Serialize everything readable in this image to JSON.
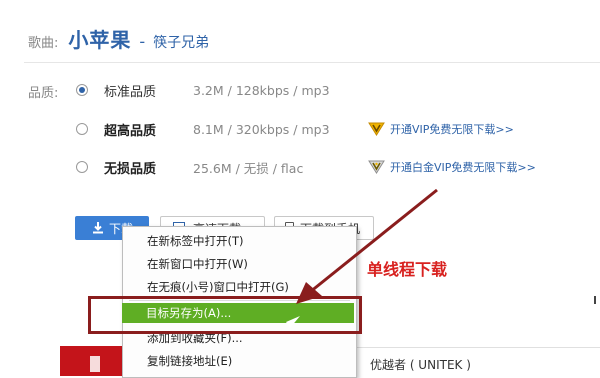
{
  "song": {
    "label": "歌曲:",
    "title": "小苹果",
    "dash": "-",
    "artist": "筷子兄弟"
  },
  "quality": {
    "label": "品质:",
    "options": [
      {
        "name": "标准品质",
        "info": "3.2M / 128kbps / mp3",
        "checked": true,
        "bold": false,
        "vip": ""
      },
      {
        "name": "超高品质",
        "info": "8.1M / 320kbps / mp3",
        "checked": false,
        "bold": true,
        "vip": "开通VIP免费无限下载>>"
      },
      {
        "name": "无损品质",
        "info": "25.6M / 无损 / flac",
        "checked": false,
        "bold": true,
        "vip": "开通白金VIP免费无限下载>>"
      }
    ]
  },
  "buttons": {
    "download": "下载",
    "high_speed": "高速下载",
    "to_phone": "下载到手机"
  },
  "context_menu": {
    "items": [
      {
        "label": "在新标签中打开(T)",
        "selected": false
      },
      {
        "label": "在新窗口中打开(W)",
        "selected": false
      },
      {
        "label": "在无痕(小号)窗口中打开(G)",
        "selected": false
      },
      {
        "label": "目标另存为(A)...",
        "selected": true
      },
      {
        "label": "添加到收藏夹(F)...",
        "selected": false
      },
      {
        "label": "复制链接地址(E)",
        "selected": false
      }
    ]
  },
  "annotation": "单线程下载",
  "bottom": {
    "text": "优越者 ( UNITEK )"
  },
  "colors": {
    "brand_blue": "#2f63a8",
    "button_blue": "#3a7fd5",
    "menu_highlight": "#5fae24",
    "annotation_red": "#d8211f",
    "box_red": "#8a1d1d",
    "strip_red": "#c4141a"
  }
}
